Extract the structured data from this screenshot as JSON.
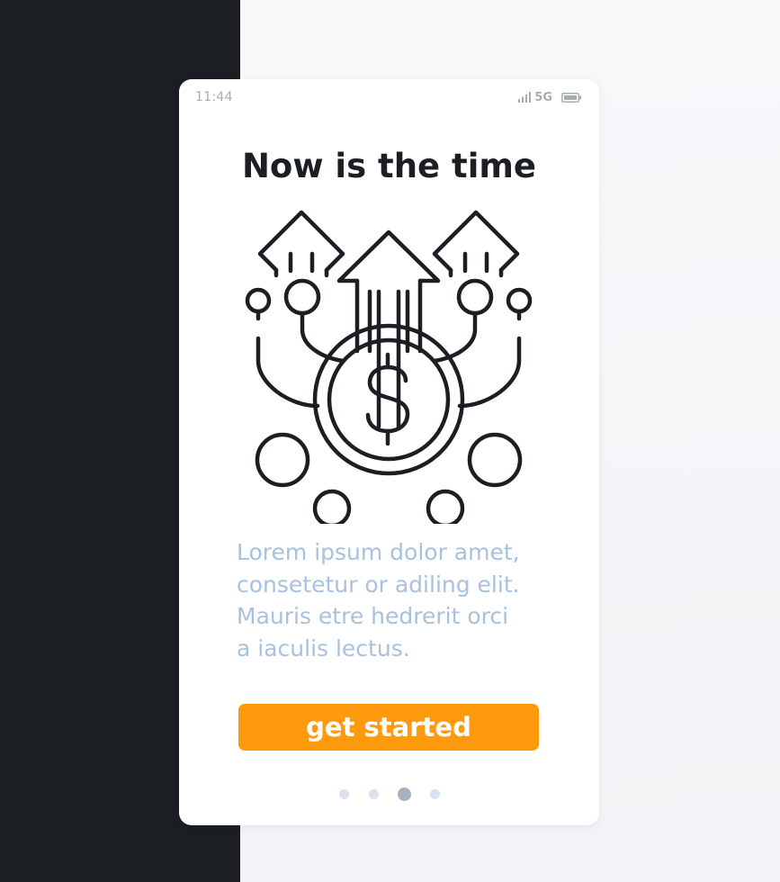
{
  "status_bar": {
    "time": "11:44",
    "network": "5G"
  },
  "screen": {
    "title": "Now is the time",
    "body_lines": [
      "Lorem ipsum dolor amet,",
      "consetetur  or adiling elit.",
      "Mauris etre  hedrerit orci",
      "a iaculis lectus."
    ],
    "cta_label": "get started"
  },
  "pager": {
    "count": 4,
    "active_index": 2
  },
  "icons": {
    "illustration": "money-growth-icon",
    "signal": "signal-icon",
    "battery": "battery-icon"
  },
  "colors": {
    "left_panel": "#1b1f23",
    "background": "#f5f6f8",
    "card": "#ffffff",
    "title": "#1b1f23",
    "body_text": "#a9c1dc",
    "accent": "#ff9a0e",
    "dot_inactive": "#d7e3ef",
    "dot_active": "#a3b1c0"
  }
}
